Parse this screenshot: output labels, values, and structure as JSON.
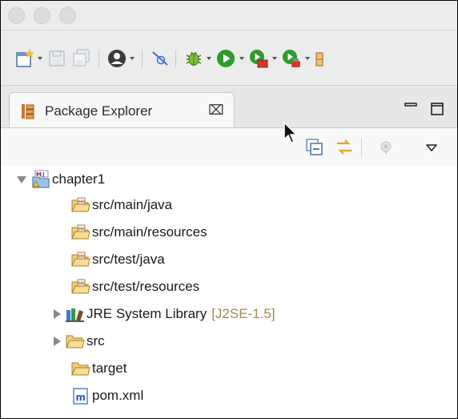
{
  "view": {
    "title": "Package Explorer",
    "close_glyph": "⌧"
  },
  "tree": {
    "project": {
      "label": "chapter1",
      "icon": "maven-project-icon"
    },
    "items": [
      {
        "label": "src/main/java",
        "icon": "source-folder-icon"
      },
      {
        "label": "src/main/resources",
        "icon": "source-folder-icon"
      },
      {
        "label": "src/test/java",
        "icon": "source-folder-icon"
      },
      {
        "label": "src/test/resources",
        "icon": "source-folder-icon"
      },
      {
        "label": "JRE System Library",
        "decoration": "[J2SE-1.5]",
        "icon": "library-icon"
      },
      {
        "label": "src",
        "icon": "folder-icon"
      },
      {
        "label": "target",
        "icon": "folder-icon"
      },
      {
        "label": "pom.xml",
        "icon": "maven-file-icon"
      }
    ]
  },
  "colors": {
    "accent_green": "#2e9b2e",
    "accent_red": "#d33a2c",
    "folder_yellow": "#e8c25a",
    "decoration": "#a58a4a"
  }
}
